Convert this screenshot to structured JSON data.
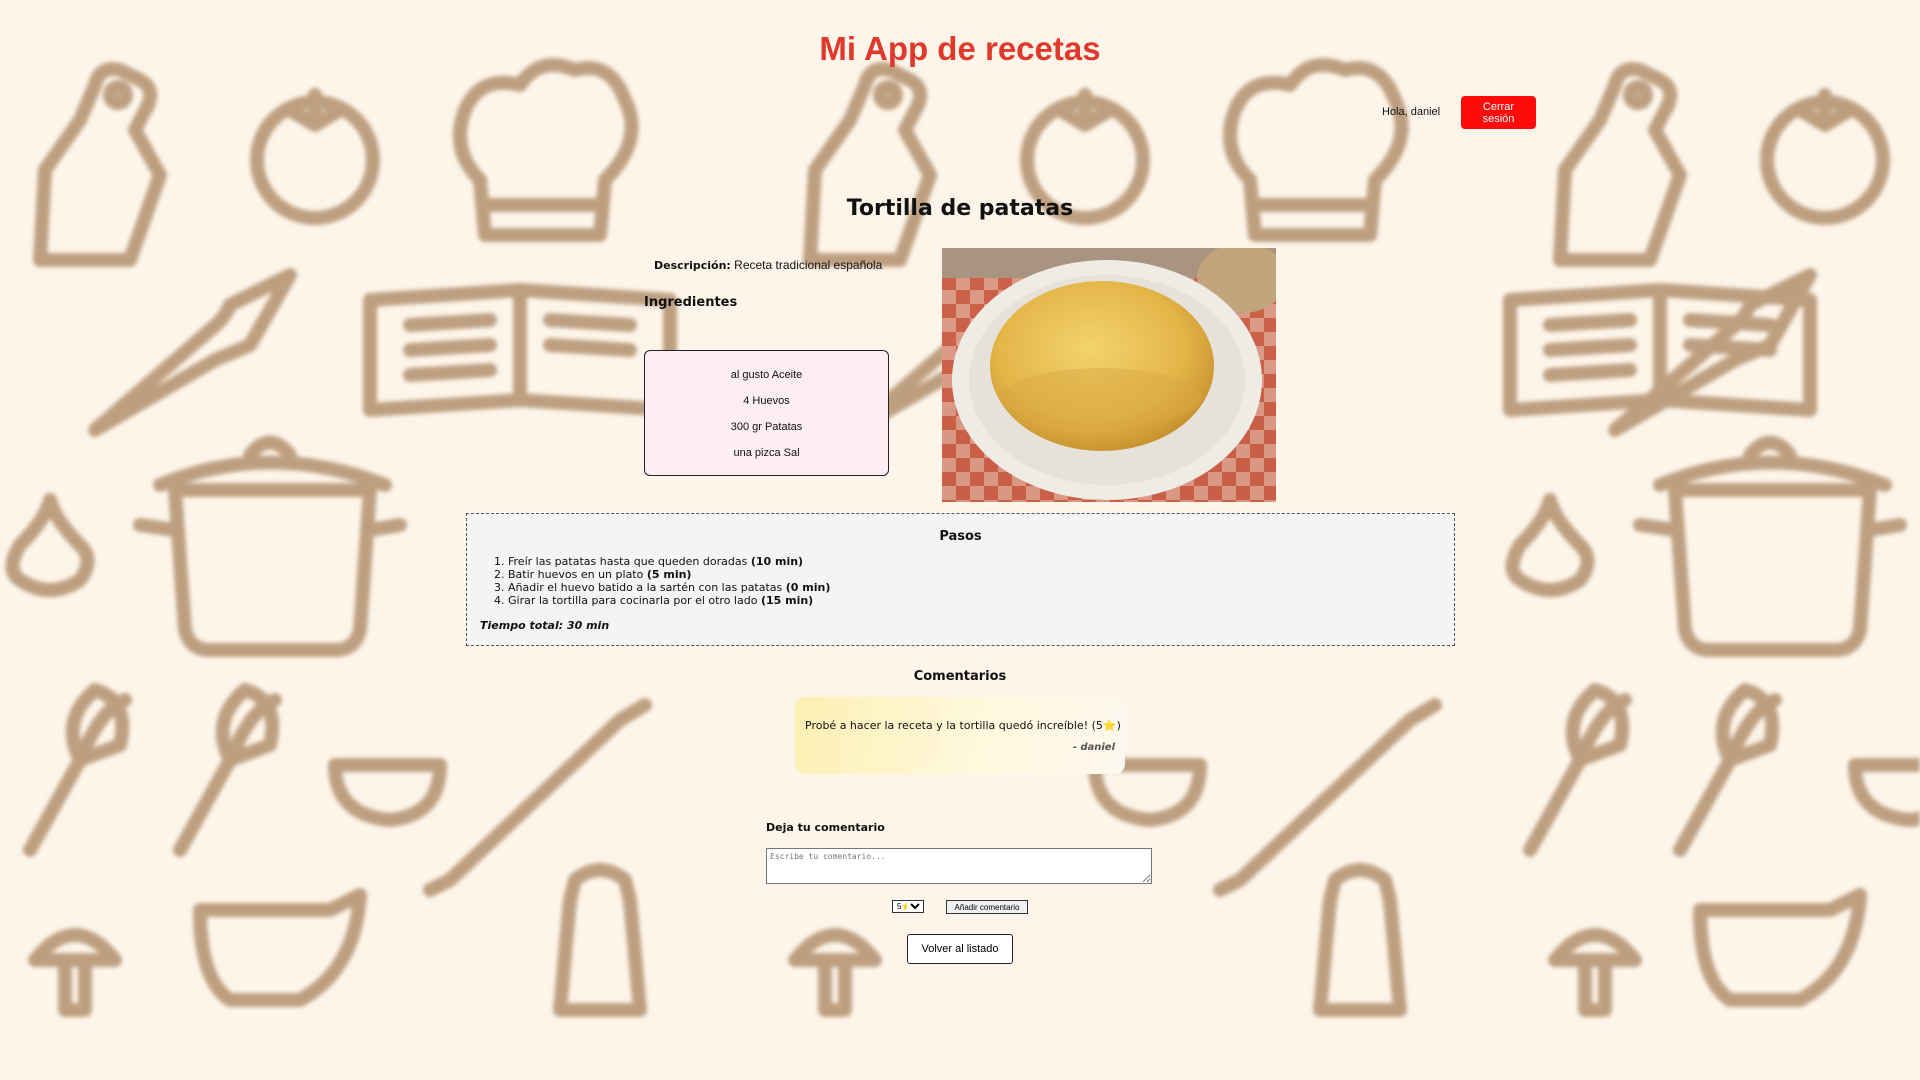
{
  "app": {
    "title": "Mi App de recetas"
  },
  "header": {
    "greeting": "Hola, daniel",
    "logout_label": "Cerrar sesión"
  },
  "recipe": {
    "title": "Tortilla de patatas",
    "description_label": "Descripción:",
    "description": "Receta tradicional española",
    "ingredients_title": "Ingredientes",
    "ingredients": [
      "al gusto Aceite",
      "4 Huevos",
      "300 gr Patatas",
      "una pizca Sal"
    ],
    "steps_title": "Pasos",
    "steps": [
      {
        "text": "Freír las patatas hasta que queden doradas",
        "time": "(10 min)"
      },
      {
        "text": "Batir huevos en un plato",
        "time": "(5 min)"
      },
      {
        "text": "Añadir el huevo batido a la sartén con las patatas",
        "time": "(0 min)"
      },
      {
        "text": "Girar la tortilla para cocinarla por el otro lado",
        "time": "(15 min)"
      }
    ],
    "total_time": "Tiempo total: 30 min"
  },
  "comments": {
    "title": "Comentarios",
    "items": [
      {
        "text": "Probé a hacer la receta y la tortilla quedó increíble! (5⭐)",
        "author": "- daniel"
      }
    ]
  },
  "new_comment": {
    "title": "Deja tu comentario",
    "placeholder": "Escribe tu comentario...",
    "rating_selected": "5⭐",
    "add_label": "Añadir comentario"
  },
  "footer": {
    "back_label": "Volver al listado"
  },
  "colors": {
    "title": "#e0392b",
    "logout_bg": "#ff0b0b",
    "page_bg": "#fdf5ea",
    "pattern": "#8a5a2b"
  },
  "icons": [
    "cutting-board-icon",
    "tomato-icon",
    "chef-hat-icon",
    "knife-icon",
    "open-book-icon",
    "pot-icon",
    "garlic-icon",
    "whisk-icon",
    "rolling-pin-icon",
    "bowl-icon",
    "salt-shaker-icon",
    "gravy-boat-icon",
    "mushroom-icon",
    "star-icon"
  ]
}
